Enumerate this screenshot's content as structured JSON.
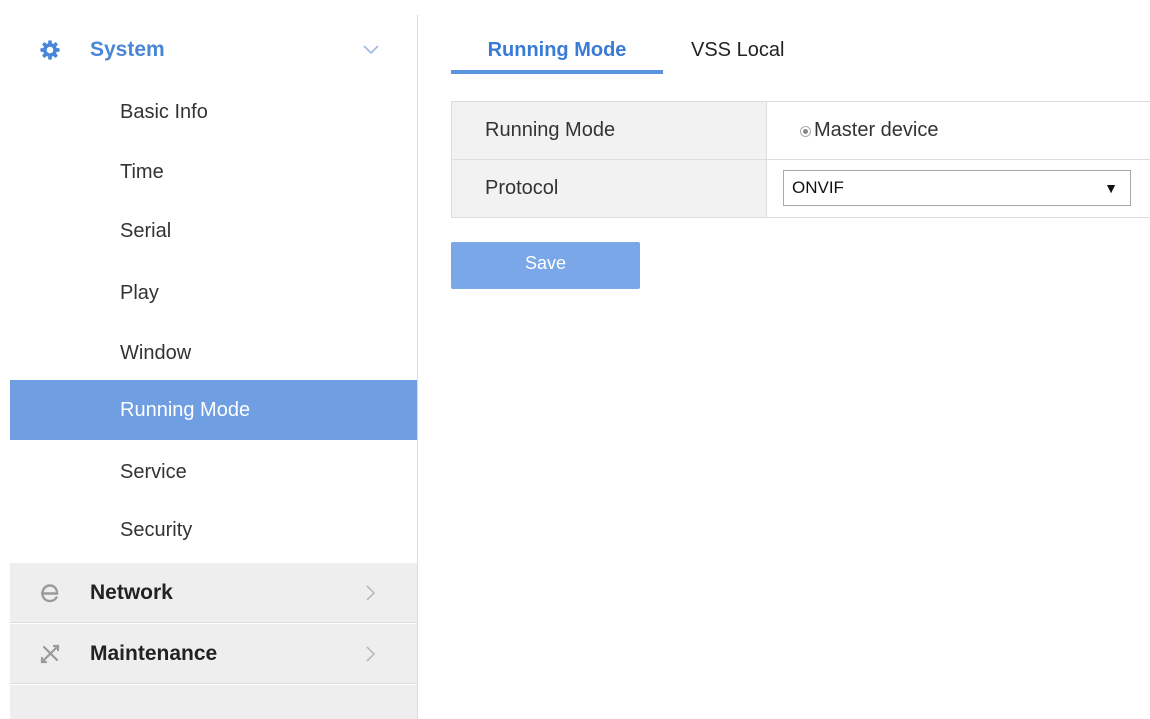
{
  "sidebar": {
    "groups": [
      {
        "title": "System",
        "icon": "gear-icon",
        "chevron": "chevron-down-icon",
        "expanded": true
      },
      {
        "title": "Network",
        "icon": "network-e-icon",
        "chevron": "chevron-right-icon",
        "expanded": false
      },
      {
        "title": "Maintenance",
        "icon": "tools-icon",
        "chevron": "chevron-right-icon",
        "expanded": false
      }
    ],
    "system_items": [
      {
        "label": "Basic Info"
      },
      {
        "label": "Time"
      },
      {
        "label": "Serial"
      },
      {
        "label": "Play"
      },
      {
        "label": "Window"
      },
      {
        "label": "Running Mode",
        "active": true
      },
      {
        "label": "Service"
      },
      {
        "label": "Security"
      }
    ]
  },
  "tabs": [
    {
      "label": "Running Mode",
      "active": true
    },
    {
      "label": "VSS Local",
      "active": false
    }
  ],
  "form": {
    "running_mode": {
      "label": "Running Mode",
      "option": "Master device",
      "selected": true
    },
    "protocol": {
      "label": "Protocol",
      "value": "ONVIF"
    }
  },
  "actions": {
    "save_label": "Save"
  },
  "colors": {
    "accent": "#4a86d8",
    "active_item_bg": "#6f9ee3",
    "save_button_bg": "#7aa7e8",
    "collapsed_group_bg": "#eeeeee",
    "label_cell_bg": "#f2f2f2"
  }
}
